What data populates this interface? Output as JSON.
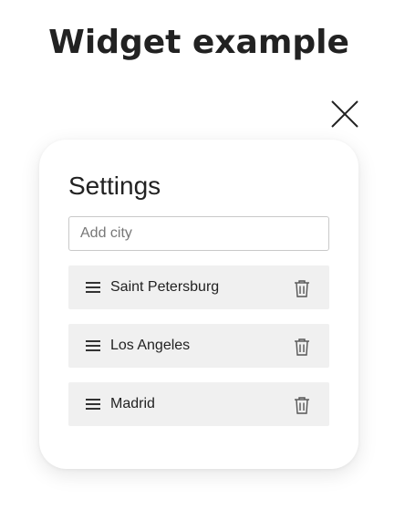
{
  "page": {
    "title": "Widget example"
  },
  "close": {
    "icon": "close-icon"
  },
  "settings": {
    "title": "Settings",
    "add_city_placeholder": "Add city",
    "add_city_value": "",
    "cities": [
      {
        "name": "Saint Petersburg",
        "handle_icon": "drag-handle-icon",
        "delete_icon": "trash-icon"
      },
      {
        "name": "Los Angeles",
        "handle_icon": "drag-handle-icon",
        "delete_icon": "trash-icon"
      },
      {
        "name": "Madrid",
        "handle_icon": "drag-handle-icon",
        "delete_icon": "trash-icon"
      }
    ]
  },
  "colors": {
    "text": "#222222",
    "item_background": "#f0f0f0",
    "input_border": "#c9c9c9",
    "icon": "#555555"
  }
}
